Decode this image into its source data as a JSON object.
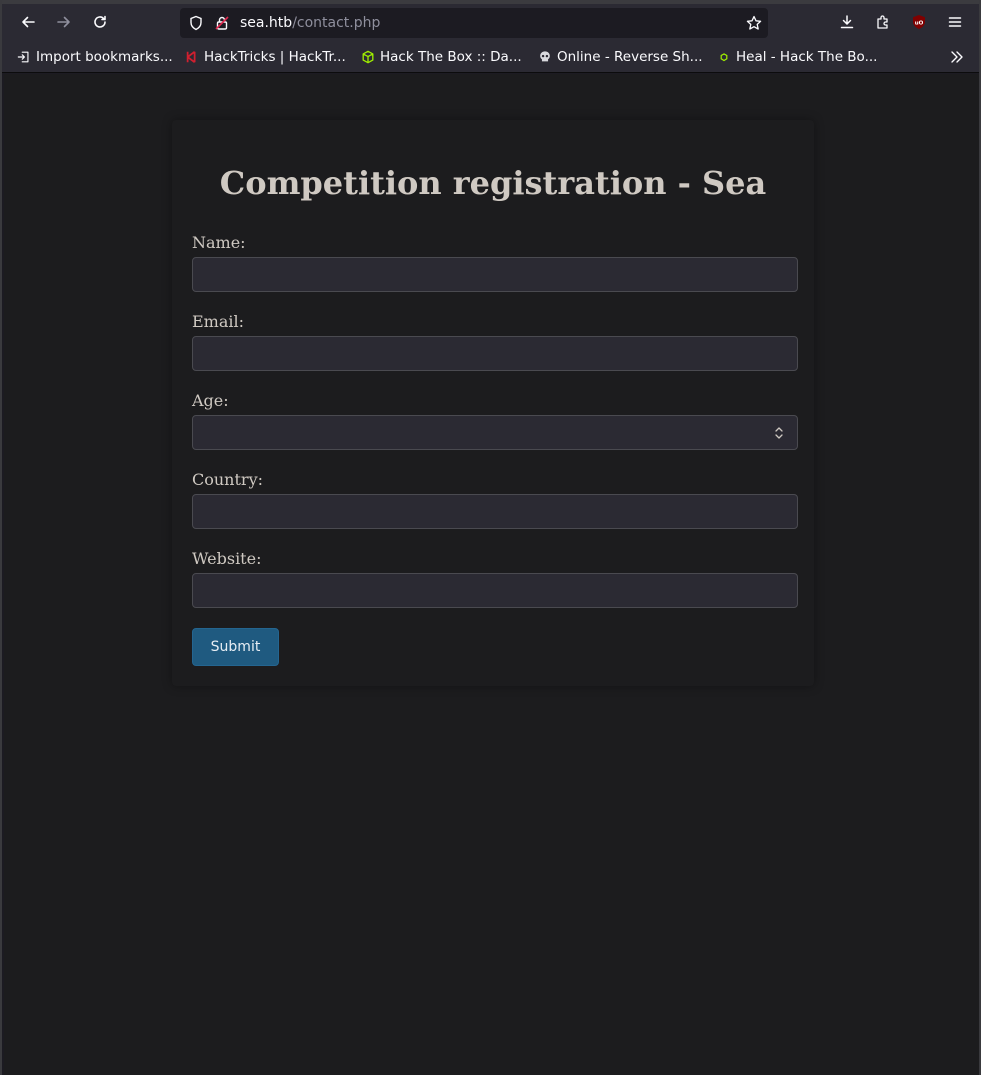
{
  "browser": {
    "url_host": "sea.htb",
    "url_path": "/contact.php",
    "bookmarks": [
      {
        "label": "Import bookmarks...",
        "icon": "import-icon"
      },
      {
        "label": "HackTricks | HackTr...",
        "icon": "hacktricks-icon"
      },
      {
        "label": "Hack The Box :: Da...",
        "icon": "htb-cube-icon"
      },
      {
        "label": "Online - Reverse Sh...",
        "icon": "skull-icon"
      },
      {
        "label": "Heal - Hack The Bo...",
        "icon": "htb-small-icon"
      }
    ]
  },
  "form": {
    "title": "Competition registration - Sea",
    "fields": [
      {
        "label": "Name:",
        "type": "text"
      },
      {
        "label": "Email:",
        "type": "email"
      },
      {
        "label": "Age:",
        "type": "select"
      },
      {
        "label": "Country:",
        "type": "text"
      },
      {
        "label": "Website:",
        "type": "text"
      }
    ],
    "submit_label": "Submit"
  },
  "colors": {
    "page_bg": "#1c1c1e",
    "input_bg": "#2b2a33",
    "submit_bg": "#1f5a80",
    "text": "#cfc9c2"
  }
}
